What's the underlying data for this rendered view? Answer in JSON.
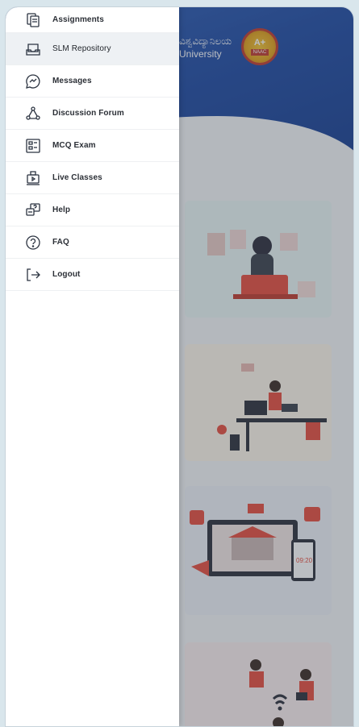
{
  "header": {
    "university_text_top": "ವಿಶ್ವವಿದ್ಯಾನಿಲಯ",
    "university_text_bottom": "University",
    "naac_grade": "A+",
    "naac_label": "NAAC"
  },
  "menu": {
    "items": [
      {
        "label": "Assignments",
        "icon": "assignments-icon"
      },
      {
        "label": "SLM Repository",
        "icon": "repository-icon",
        "active": true
      },
      {
        "label": "Messages",
        "icon": "messages-icon"
      },
      {
        "label": "Discussion Forum",
        "icon": "forum-icon"
      },
      {
        "label": "MCQ Exam",
        "icon": "exam-icon"
      },
      {
        "label": "Live Classes",
        "icon": "live-class-icon"
      },
      {
        "label": "Help",
        "icon": "help-icon"
      },
      {
        "label": "FAQ",
        "icon": "faq-icon"
      },
      {
        "label": "Logout",
        "icon": "logout-icon"
      }
    ]
  },
  "cards": {
    "watch_time": "09:20"
  },
  "colors": {
    "hero": "#1e4aa3",
    "accent_red": "#e74c3c",
    "overlay": "rgba(60,70,80,0.35)"
  }
}
